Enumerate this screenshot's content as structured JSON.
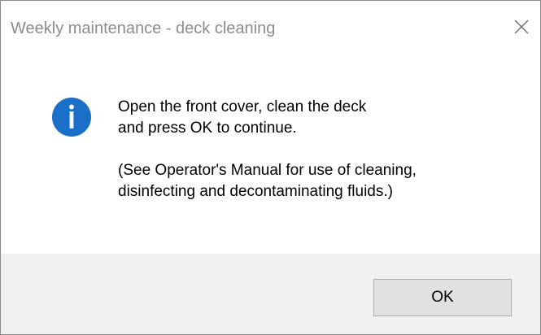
{
  "window": {
    "title": "Weekly maintenance - deck cleaning",
    "close_icon": "close-icon"
  },
  "message": {
    "icon": "info-icon",
    "icon_color": "#1a6fc9",
    "line1": "Open the front cover, clean the deck",
    "line2": "and press OK to continue.",
    "line3": "(See Operator's Manual for use of cleaning,",
    "line4": "disinfecting and decontaminating fluids.)"
  },
  "buttons": {
    "ok_label": "OK"
  },
  "colors": {
    "footer_bg": "#f0f0f0",
    "button_bg": "#e1e1e1",
    "button_border": "#adadad",
    "title_text": "#8c8c8c"
  }
}
